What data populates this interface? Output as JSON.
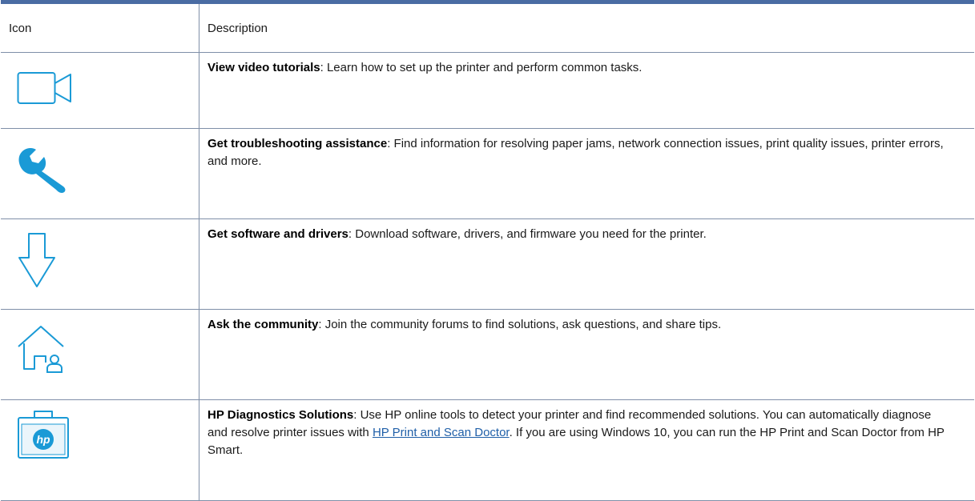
{
  "table": {
    "headers": {
      "icon": "Icon",
      "description": "Description"
    },
    "rows": [
      {
        "icon": "video-camera-icon",
        "lead": "View video tutorials",
        "text": ": Learn how to set up the printer and perform common tasks."
      },
      {
        "icon": "wrench-icon",
        "lead": "Get troubleshooting assistance",
        "text": ": Find information for resolving paper jams, network connection issues, print quality issues, printer errors, and more."
      },
      {
        "icon": "download-arrow-icon",
        "lead": "Get software and drivers",
        "text": ": Download software, drivers, and firmware you need for the printer."
      },
      {
        "icon": "community-home-icon",
        "lead": "Ask the community",
        "text": ": Join the community forums to find solutions, ask questions, and share tips."
      },
      {
        "icon": "hp-diagnostics-toolbox-icon",
        "lead": "HP Diagnostics Solutions",
        "text_before_link": ": Use HP online tools to detect your printer and find recommended solutions. You can automatically diagnose and resolve printer issues with ",
        "link": "HP Print and Scan Doctor",
        "text_after_link": ". If you are using Windows 10, you can run the HP Print and Scan Doctor from HP Smart.",
        "logo_text": "hp"
      }
    ]
  },
  "colors": {
    "icon_blue": "#1a9ad6",
    "header_rule": "#4a6ca3",
    "link": "#1f5fa8"
  }
}
